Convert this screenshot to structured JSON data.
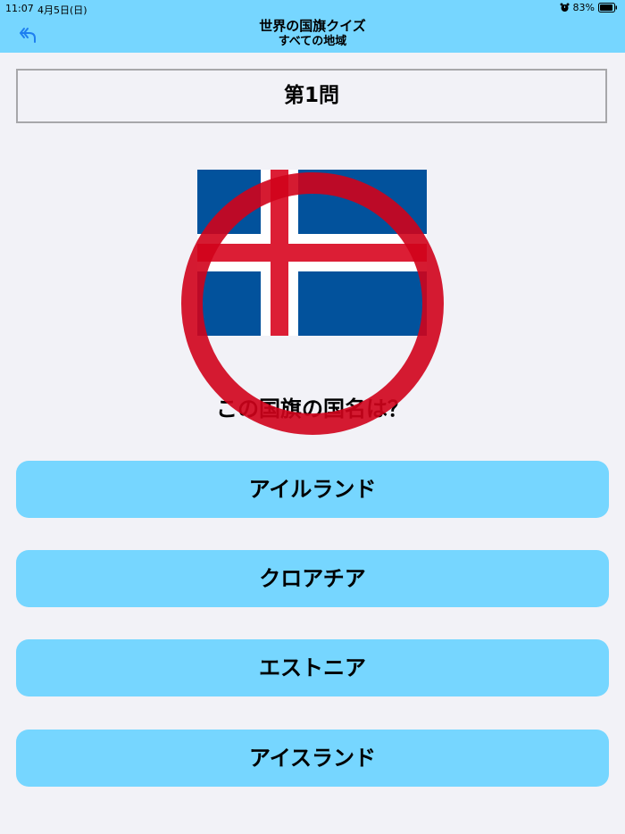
{
  "status_bar": {
    "time": "11:07",
    "date": "4月5日(日)",
    "battery": "83%",
    "alarm_icon": "alarm-clock-icon",
    "battery_icon": "battery-icon"
  },
  "nav": {
    "title": "世界の国旗クイズ",
    "subtitle": "すべての地域",
    "back_icon": "undo-arrow-icon"
  },
  "question": {
    "number_label": "第1問",
    "prompt": "この国旗の国名は？",
    "flag": "iceland-flag",
    "result_mark": "correct-circle"
  },
  "answers": [
    {
      "label": "アイルランド"
    },
    {
      "label": "クロアチア"
    },
    {
      "label": "エストニア"
    },
    {
      "label": "アイスランド"
    }
  ],
  "colors": {
    "accent": "#76d6ff",
    "background": "#f2f2f7",
    "flag_blue": "#02529c",
    "flag_red": "#dc1e35",
    "flag_white": "#ffffff",
    "mark_red": "#d0021b"
  }
}
